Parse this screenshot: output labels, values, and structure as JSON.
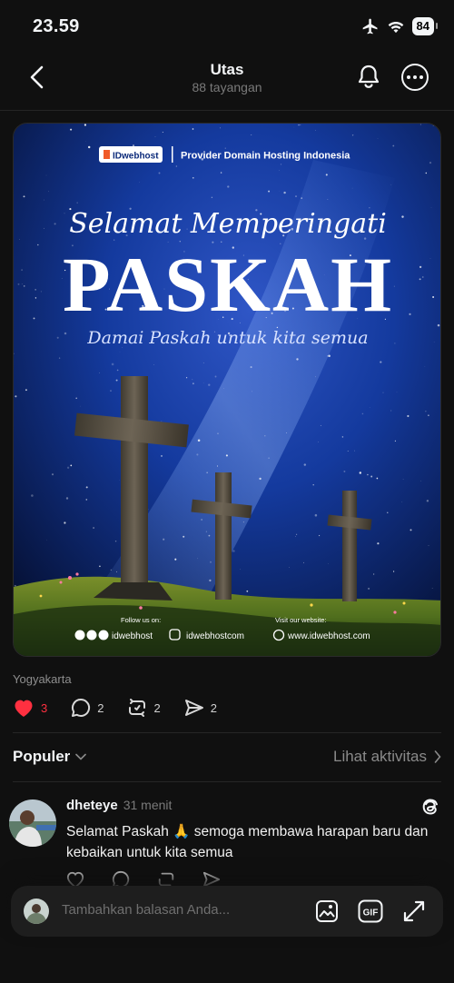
{
  "status_bar": {
    "time": "23.59",
    "battery": "84"
  },
  "nav": {
    "title": "Utas",
    "subtitle": "88 tayangan"
  },
  "post": {
    "image": {
      "brand": "IDwebhost",
      "tagline": "Provider Domain Hosting Indonesia",
      "script_heading": "Selamat Memperingati",
      "headline": "PASKAH",
      "script_subheading": "Damai Paskah untuk kita semua",
      "follow_label": "Follow us on:",
      "social_handle": "idwebhost",
      "instagram_handle": "idwebhostcom",
      "website_label": "Visit our website:",
      "website": "www.idwebhost.com"
    },
    "location": "Yogyakarta",
    "likes": "3",
    "comments": "2",
    "reposts": "2",
    "shares": "2"
  },
  "sort": {
    "label": "Populer",
    "activity_link": "Lihat aktivitas"
  },
  "reply": {
    "username": "dheteye",
    "time": "31 menit",
    "text": "Selamat Paskah 🙏 semoga membawa harapan baru dan kebaikan untuk kita semua"
  },
  "composer": {
    "placeholder": "Tambahkan balasan Anda..."
  },
  "colors": {
    "background": "#101010",
    "like_red": "#ff3040",
    "muted": "#8e8e8e"
  }
}
